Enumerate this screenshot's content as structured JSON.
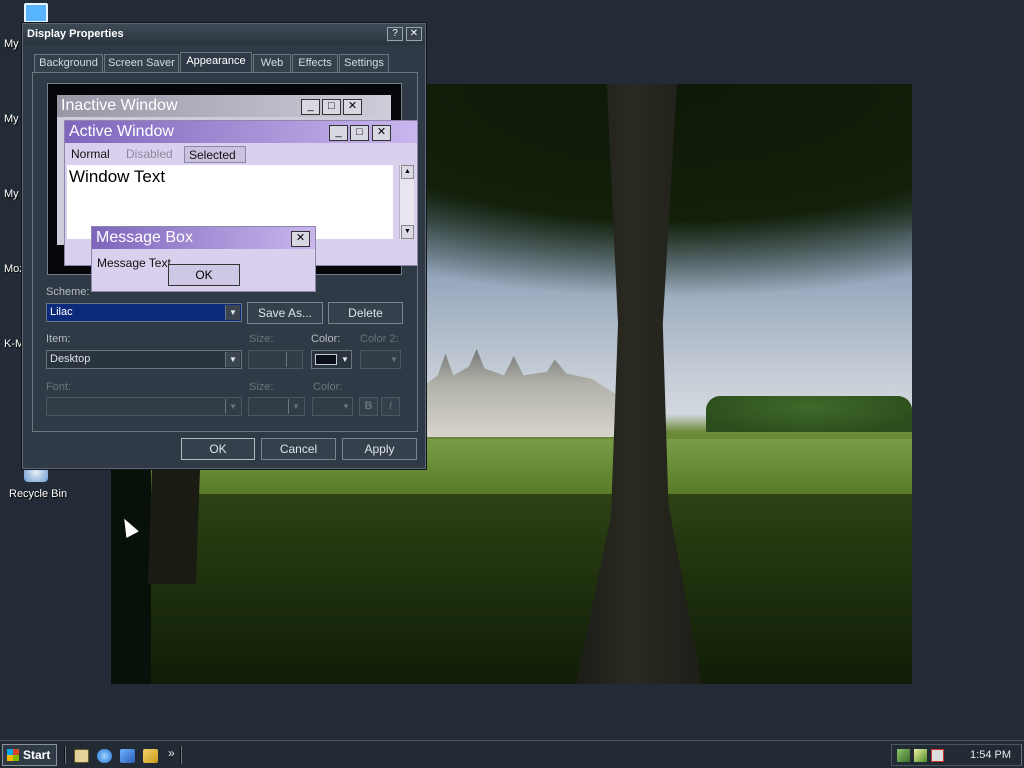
{
  "desktop": {
    "icons": [
      {
        "label": "My"
      },
      {
        "label": "My D"
      },
      {
        "label": "My"
      },
      {
        "label": "Moz"
      },
      {
        "label": "K-M"
      },
      {
        "label": "Recycle Bin"
      }
    ]
  },
  "dialog": {
    "title": "Display Properties",
    "help_glyph": "?",
    "close_glyph": "✕",
    "tabs": [
      "Background",
      "Screen Saver",
      "Appearance",
      "Web",
      "Effects",
      "Settings"
    ],
    "active_tab": "Appearance",
    "preview": {
      "inactive_title": "Inactive Window",
      "active_title": "Active Window",
      "menu": [
        "Normal",
        "Disabled",
        "Selected"
      ],
      "window_text": "Window Text",
      "message_box_title": "Message Box",
      "message_text": "Message Text",
      "ok_label": "OK",
      "min_glyph": "_",
      "max_glyph": "□",
      "close_glyph": "✕",
      "scroll_up": "▲",
      "scroll_down": "▼"
    },
    "scheme": {
      "label": "Scheme:",
      "value": "Lilac",
      "save_as": "Save As...",
      "delete": "Delete"
    },
    "item": {
      "label": "Item:",
      "value": "Desktop",
      "size_label": "Size:",
      "color_label": "Color:",
      "color2_label": "Color 2:",
      "color_value": "#0b0f17"
    },
    "font": {
      "label": "Font:",
      "size_label": "Size:",
      "color_label": "Color:",
      "bold": "B",
      "italic": "I"
    },
    "buttons": {
      "ok": "OK",
      "cancel": "Cancel",
      "apply": "Apply"
    },
    "dropdown_glyph": "▼"
  },
  "taskbar": {
    "start_label": "Start",
    "chevron": "»",
    "clock": "1:54 PM"
  },
  "colors": {
    "desktop": "#232c36",
    "scheme_selected": "#0c2a7c",
    "active_title_from": "#7e66bc",
    "active_title_to": "#c9b6ee"
  }
}
